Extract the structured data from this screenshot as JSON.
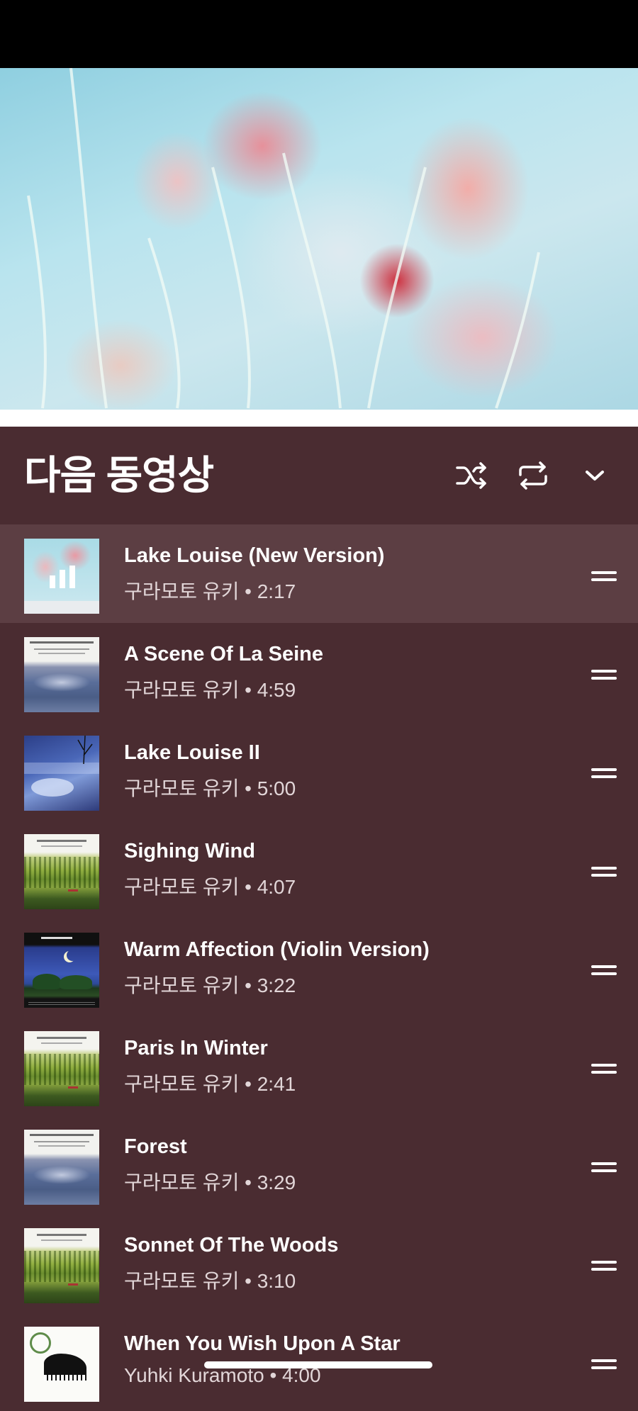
{
  "panel": {
    "title": "다음 동영상"
  },
  "header_icons": {
    "shuffle": "shuffle-icon",
    "repeat": "repeat-icon",
    "collapse": "chevron-down-icon"
  },
  "colors": {
    "background": "#4a2c31",
    "active_row": "#5c3e43",
    "meta_text": "#e2d6d8"
  },
  "tracks": [
    {
      "title": "Lake Louise (New Version)",
      "meta": "구라모토 유키 • 2:17",
      "thumbnail": "poppy-album-art",
      "playing": true
    },
    {
      "title": "A Scene Of La Seine",
      "meta": "구라모토 유키 • 4:59",
      "thumbnail": "refinement-album-art"
    },
    {
      "title": "Lake Louise II",
      "meta": "구라모토 유키 • 5:00",
      "thumbnail": "lake-louise-album-art"
    },
    {
      "title": "Sighing Wind",
      "meta": "구라모토 유키 • 4:07",
      "thumbnail": "reminiscence-album-art"
    },
    {
      "title": "Warm Affection (Violin Version)",
      "meta": "구라모토 유키 • 3:22",
      "thumbnail": "night-moon-album-art"
    },
    {
      "title": "Paris In Winter",
      "meta": "구라모토 유키 • 2:41",
      "thumbnail": "reminiscence-album-art"
    },
    {
      "title": "Forest",
      "meta": "구라모토 유키 • 3:29",
      "thumbnail": "refinement-album-art"
    },
    {
      "title": "Sonnet Of The Woods",
      "meta": "구라모토 유키 • 3:10",
      "thumbnail": "reminiscence-album-art"
    },
    {
      "title": "When You Wish Upon A Star",
      "meta": "Yuhki Kuramoto • 4:00",
      "thumbnail": "piano-album-art"
    }
  ]
}
